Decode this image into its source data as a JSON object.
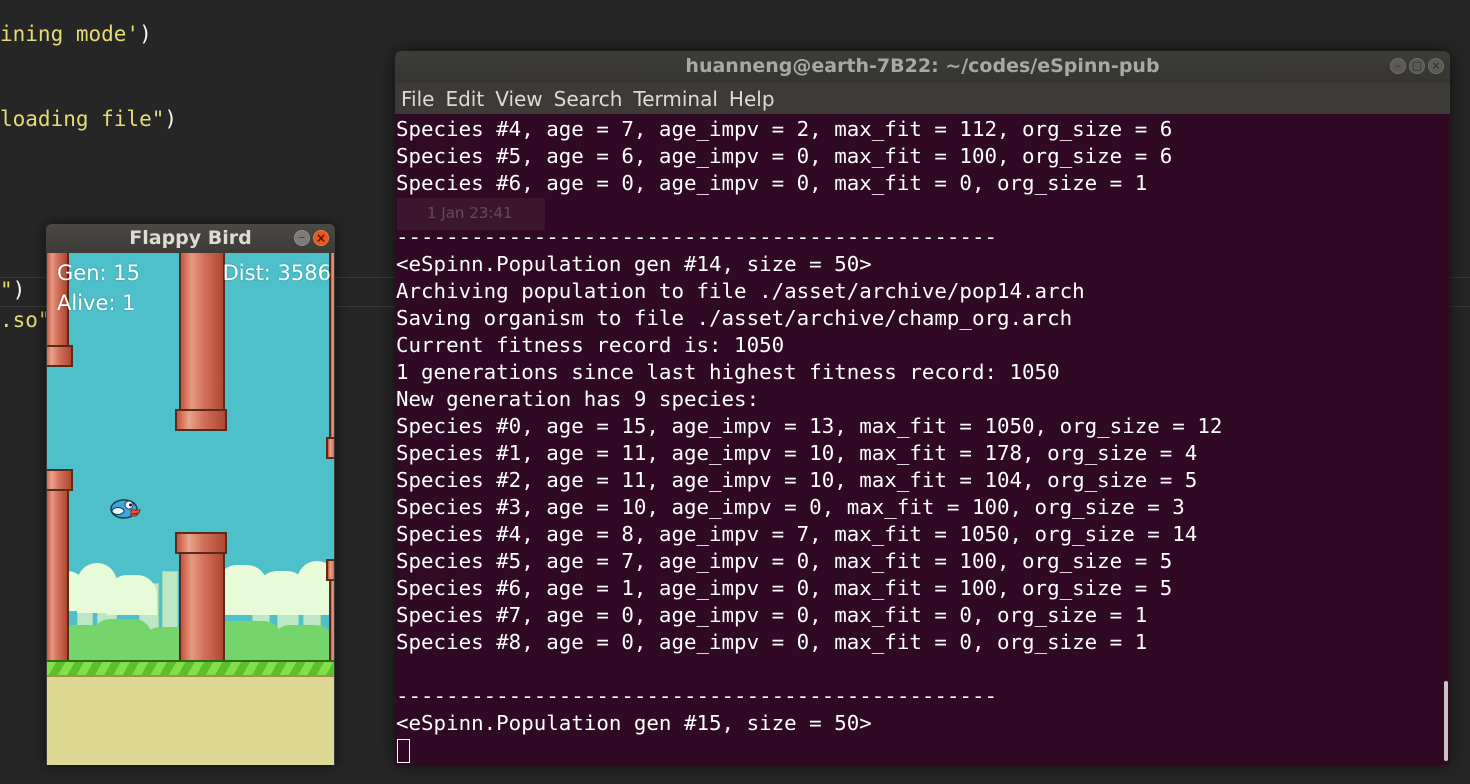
{
  "editor": {
    "lines": [
      {
        "str": "ining mode'",
        "par": ")"
      },
      {
        "str": "loading file\"",
        "par": ")"
      },
      {
        "str": "\"",
        "par": ")"
      },
      {
        "str": ".so\"",
        "par": ""
      }
    ]
  },
  "terminal": {
    "title": "huanneng@earth-7B22: ~/codes/eSpinn-pub",
    "menu": [
      "File",
      "Edit",
      "View",
      "Search",
      "Terminal",
      "Help"
    ],
    "ghost_notification": "1 Jan 23:41",
    "lines": [
      "Species #4, age = 7, age_impv = 2, max_fit = 112, org_size = 6",
      "Species #5, age = 6, age_impv = 0, max_fit = 100, org_size = 6",
      "Species #6, age = 0, age_impv = 0, max_fit = 0, org_size = 1",
      "",
      "------------------------------------------------",
      "<eSpinn.Population gen #14, size = 50>",
      "Archiving population to file ./asset/archive/pop14.arch",
      "Saving organism to file ./asset/archive/champ_org.arch",
      "Current fitness record is: 1050",
      "1 generations since last highest fitness record: 1050",
      "New generation has 9 species:",
      "Species #0, age = 15, age_impv = 13, max_fit = 1050, org_size = 12",
      "Species #1, age = 11, age_impv = 10, max_fit = 178, org_size = 4",
      "Species #2, age = 11, age_impv = 10, max_fit = 104, org_size = 5",
      "Species #3, age = 10, age_impv = 0, max_fit = 100, org_size = 3",
      "Species #4, age = 8, age_impv = 7, max_fit = 1050, org_size = 14",
      "Species #5, age = 7, age_impv = 0, max_fit = 100, org_size = 5",
      "Species #6, age = 1, age_impv = 0, max_fit = 100, org_size = 5",
      "Species #7, age = 0, age_impv = 0, max_fit = 0, org_size = 1",
      "Species #8, age = 0, age_impv = 0, max_fit = 0, org_size = 1",
      "",
      "------------------------------------------------",
      "<eSpinn.Population gen #15, size = 50>"
    ]
  },
  "flappy": {
    "title": "Flappy Bird",
    "gen_text": "Gen: 15",
    "alive_text": "Alive: 1",
    "dist_text": "Dist: 3586",
    "minimize_glyph": "–",
    "close_glyph": "×",
    "colors": {
      "sky": "#4ec0ca",
      "ground": "#ded895",
      "pipe": "#d1705a"
    }
  }
}
